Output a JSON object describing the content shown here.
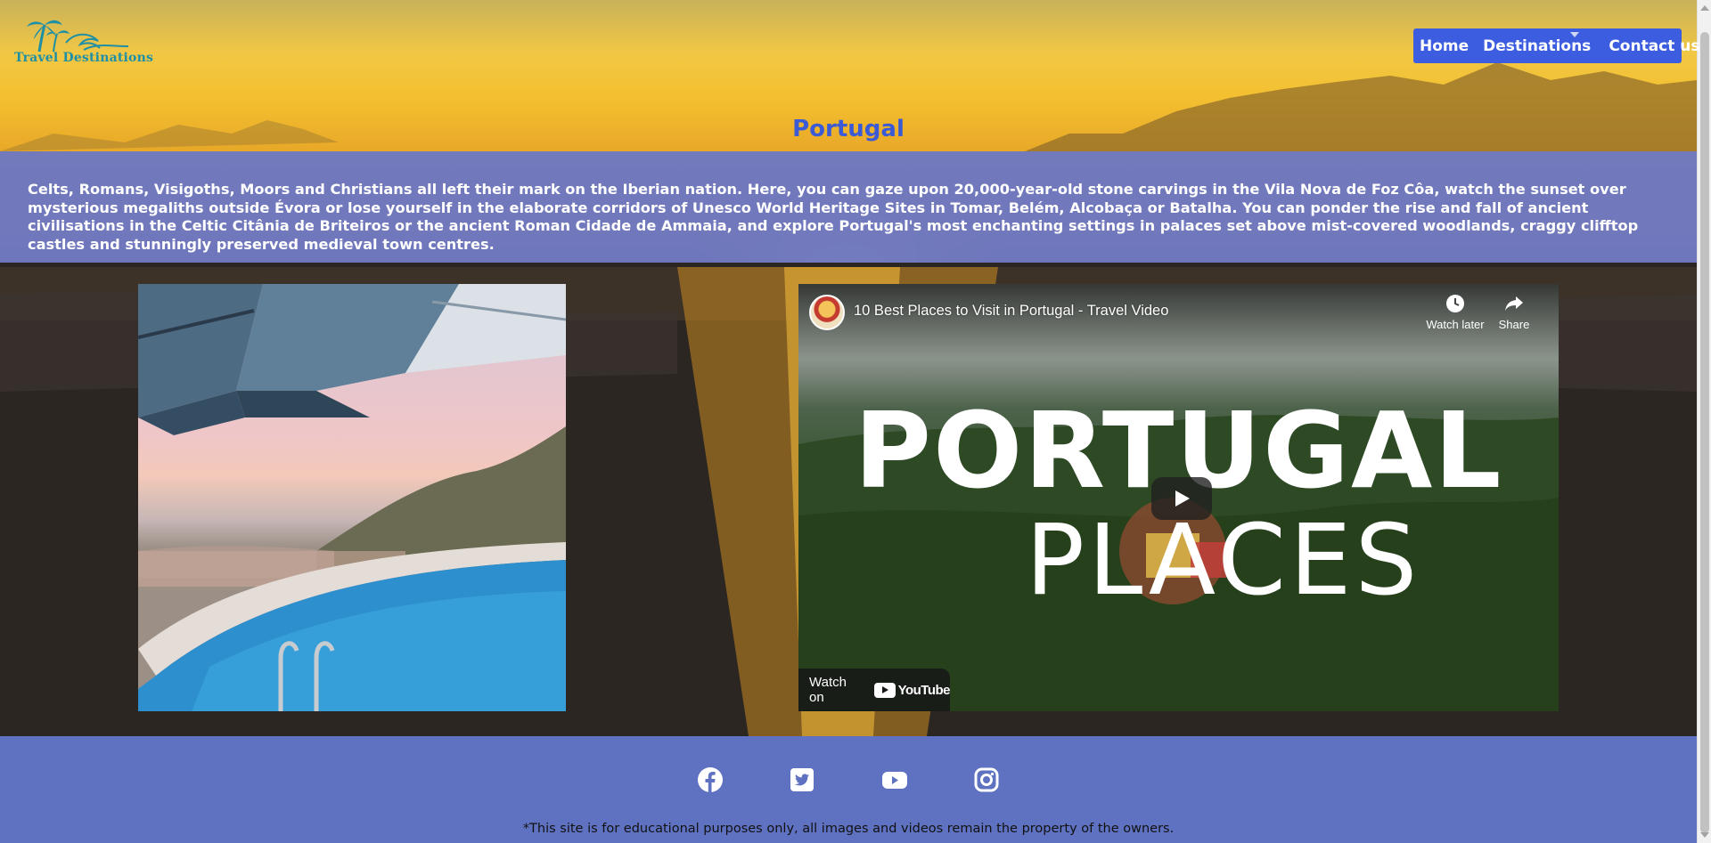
{
  "site": {
    "logo_text": "Travel Destinations"
  },
  "nav": {
    "items": [
      {
        "label": "Home"
      },
      {
        "label": "Destinations"
      },
      {
        "label": "Contact us"
      }
    ]
  },
  "page": {
    "title": "Portugal",
    "intro": "Celts, Romans, Visigoths, Moors and Christians all left their mark on the Iberian nation. Here, you can gaze upon 20,000-year-old stone carvings in the Vila Nova de Foz Côa, watch the sunset over mysterious megaliths outside Évora or lose yourself in the elaborate corridors of Unesco World Heritage Sites in Tomar, Belém, Alcobaça or Batalha. You can ponder the rise and fall of ancient civilisations in the Celtic Citânia de Briteiros or the ancient Roman Cidade de Ammaia, and explore Portugal's most enchanting settings in palaces set above mist-covered woodlands, craggy clifftop castles and stunningly preserved medieval town centres."
  },
  "video": {
    "title": "10 Best Places to Visit in Portugal - Travel Video",
    "watch_later": "Watch later",
    "share": "Share",
    "thumb_line1": "PORTUGAL",
    "thumb_line2": "PLACES",
    "watch_on": "Watch on",
    "youtube": "YouTube"
  },
  "footer": {
    "social_icons": [
      "facebook-icon",
      "twitter-icon",
      "youtube-icon",
      "instagram-icon"
    ],
    "disclaimer": "*This site is for educational purposes only, all images and videos remain the property of the owners."
  },
  "colors": {
    "nav_bg": "#3c5de0",
    "title": "#3b5bd6",
    "intro_band": "#6876c8",
    "footer_bg": "#5f72c2"
  }
}
